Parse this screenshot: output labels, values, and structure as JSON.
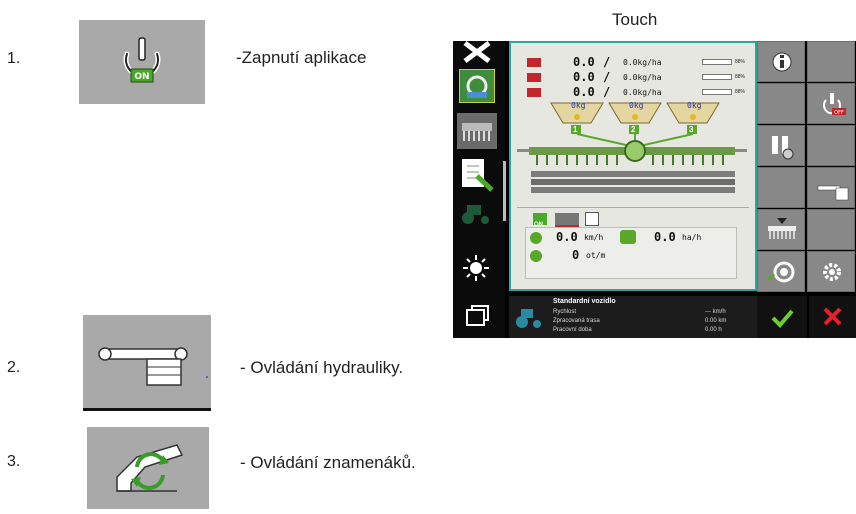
{
  "touch_label": "Touch",
  "items": [
    {
      "number": "1.",
      "description": "-Zapnutí aplikace",
      "tile_badge": "ON"
    },
    {
      "number": "2.",
      "description": "- Ovládání hydrauliky."
    },
    {
      "number": "3.",
      "description": "- Ovládání znamenáků."
    }
  ],
  "terminal": {
    "rows": [
      {
        "speed": "0.0",
        "sep": "/",
        "rate": "0.0kg/ha",
        "pct": "88%"
      },
      {
        "speed": "0.0",
        "sep": "/",
        "rate": "0.0kg/ha",
        "pct": "88%"
      },
      {
        "speed": "0.0",
        "sep": "/",
        "rate": "0.0kg/ha",
        "pct": "88%"
      }
    ],
    "hoppers": [
      {
        "label": "1",
        "kg": "0kg"
      },
      {
        "label": "2",
        "kg": "0kg"
      },
      {
        "label": "3",
        "kg": "0kg"
      }
    ],
    "on_badge": "ON",
    "off_badge": "OFF",
    "speed_value": "0.0",
    "speed_unit": "km/h",
    "area_value": "0.0",
    "area_unit": "ha/h",
    "rpm_value": "0",
    "rpm_unit": "ot/m",
    "status": {
      "title": "Standardní vozidlo",
      "lines": [
        {
          "label": "Rychlost",
          "value": "--- km/h"
        },
        {
          "label": "Zpracovaná trasa",
          "value": "0.00 km"
        },
        {
          "label": "Pracovní doba",
          "value": "0.00 h"
        }
      ]
    },
    "accent_color": "#2aa5a0",
    "confirm_color": "#6ccf2e",
    "cancel_color": "#e0232a"
  }
}
